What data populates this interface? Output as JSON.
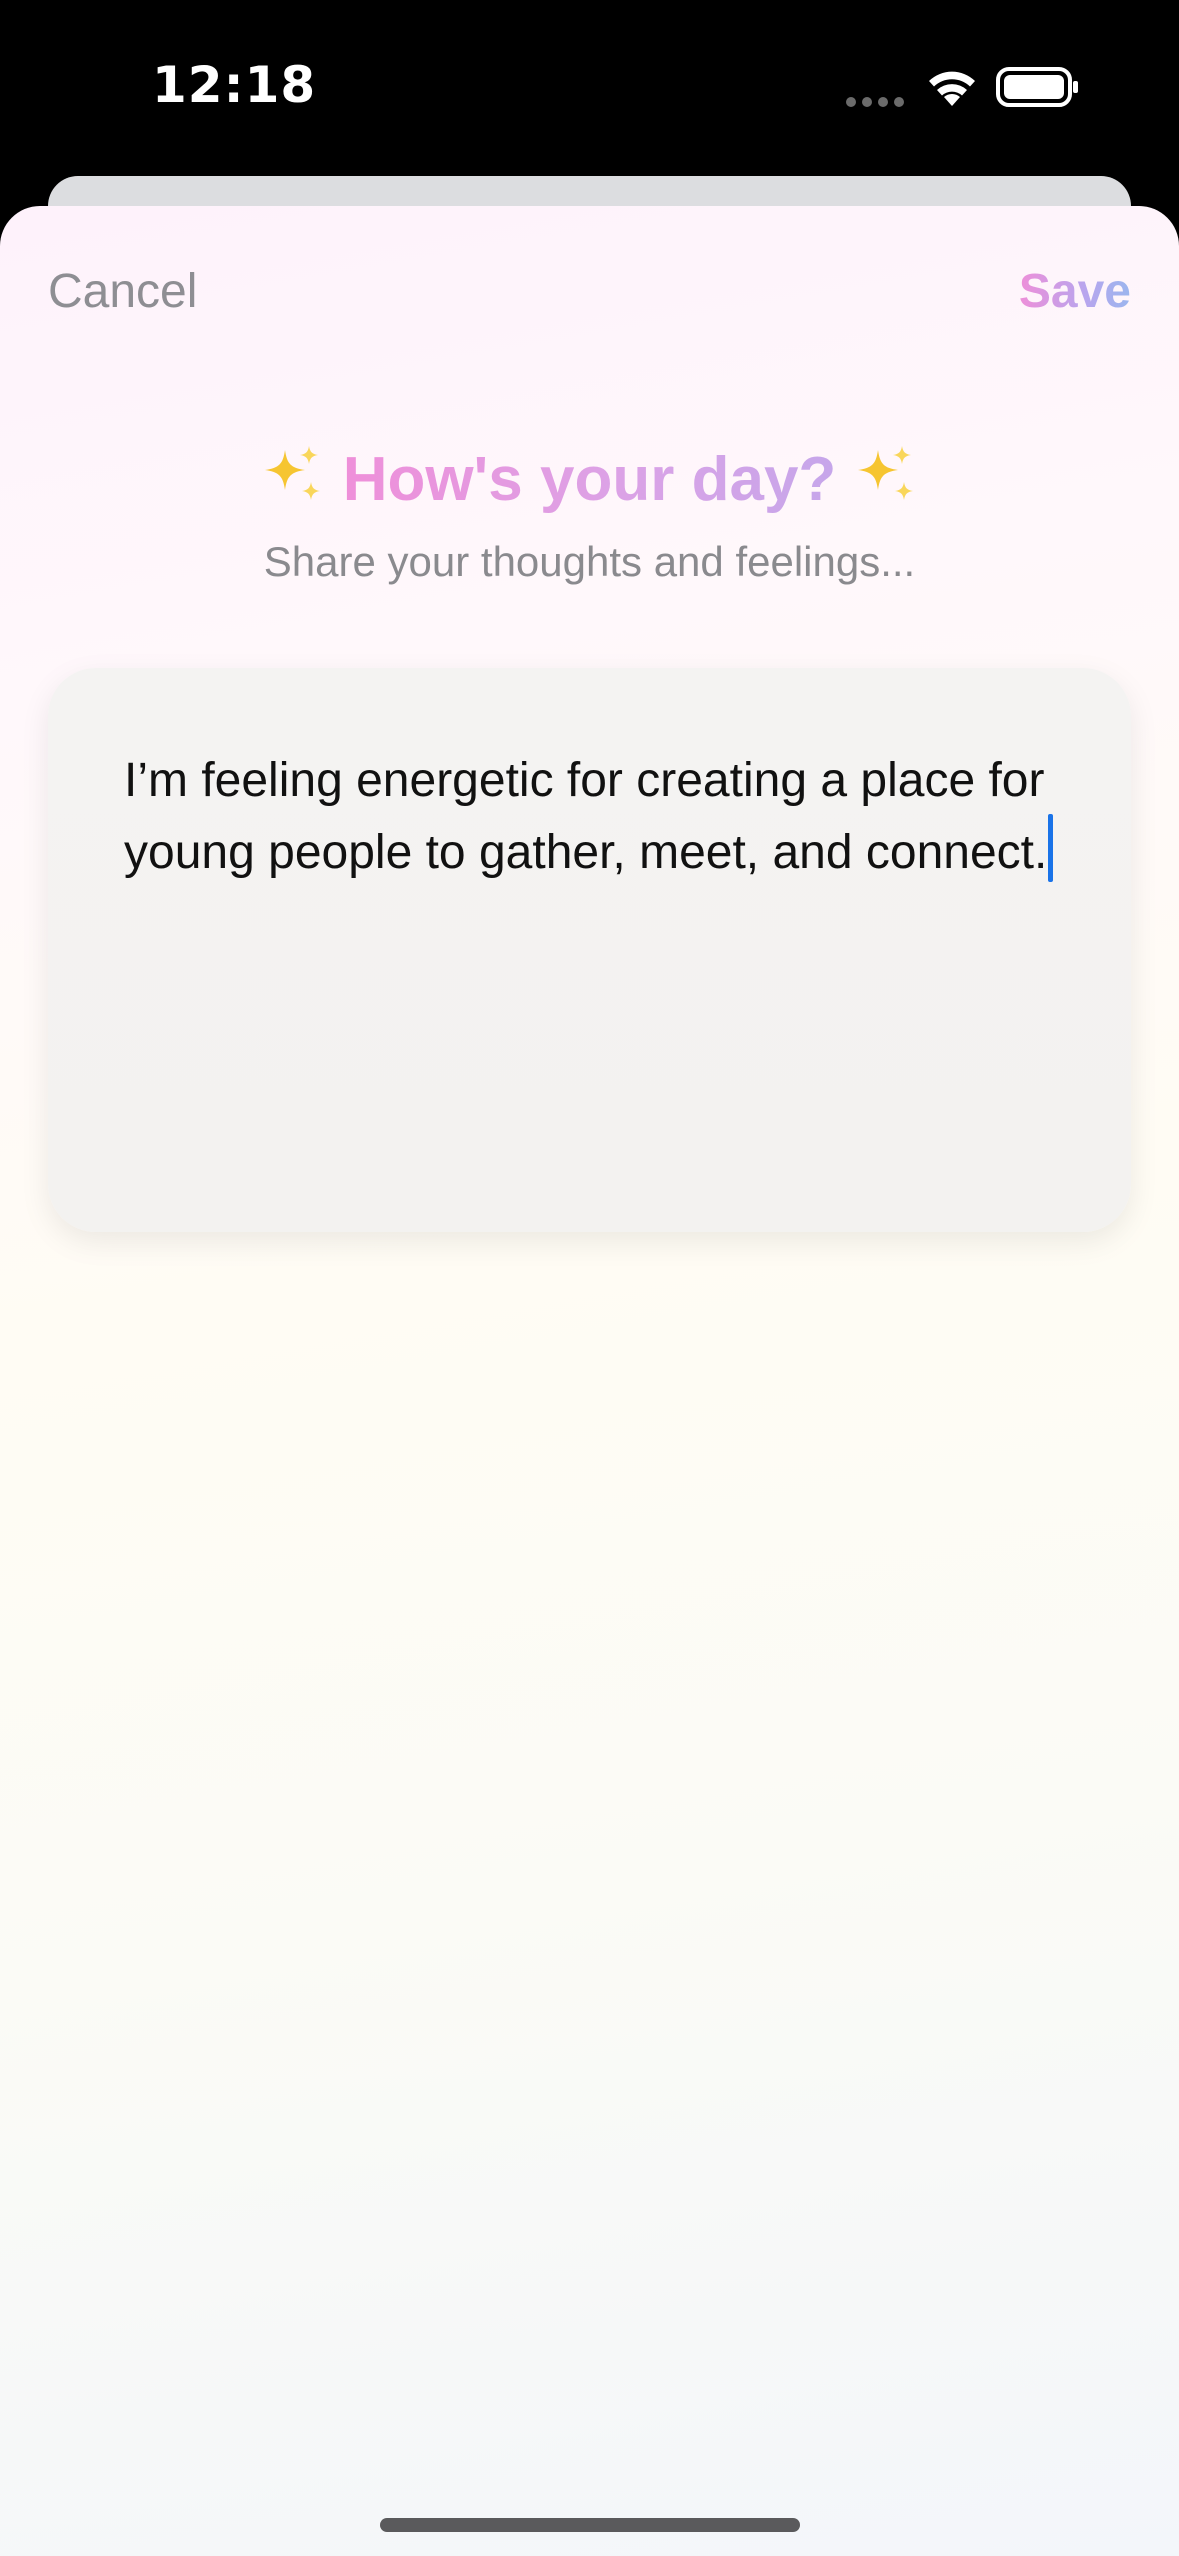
{
  "status_bar": {
    "time": "12:18",
    "icons": [
      "signal-dots-icon",
      "wifi-icon",
      "battery-icon"
    ]
  },
  "nav": {
    "cancel_label": "Cancel",
    "save_label": "Save"
  },
  "header": {
    "sparkle_icon": "✨",
    "title": "How's your day?",
    "subtitle": "Share your thoughts and feelings..."
  },
  "entry": {
    "text": "I’m feeling energetic for creating a place for young people to gather, meet, and connect."
  },
  "colors": {
    "title_gradient_start": "#ef8fd9",
    "title_gradient_end": "#c6a6ea",
    "save_gradient_start": "#ee8fd9",
    "save_gradient_end": "#9ab6ee",
    "cancel": "#8e8e93",
    "cursor": "#1a73e8"
  }
}
